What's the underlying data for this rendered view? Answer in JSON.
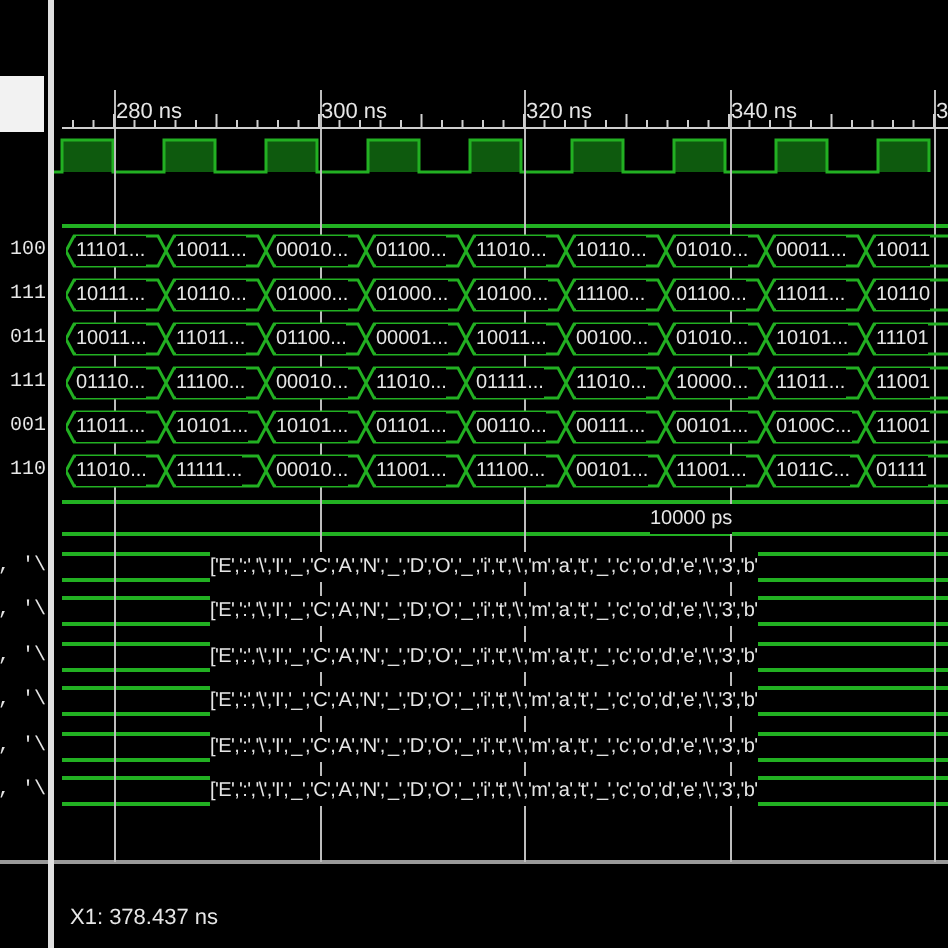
{
  "ruler": {
    "labels": [
      "280 ns",
      "300 ns",
      "320 ns",
      "340 ns",
      "3"
    ]
  },
  "signals": [
    {
      "value": "100",
      "segments": [
        "11101...",
        "10011...",
        "00010...",
        "01100...",
        "11010...",
        "10110...",
        "01010...",
        "00011...",
        "10011"
      ]
    },
    {
      "value": "111",
      "segments": [
        "10111...",
        "10110...",
        "01000...",
        "01000...",
        "10100...",
        "11100...",
        "01100...",
        "11011...",
        "10110"
      ]
    },
    {
      "value": "011",
      "segments": [
        "10011...",
        "11011...",
        "01100...",
        "00001...",
        "10011...",
        "00100...",
        "01010...",
        "10101...",
        "11101"
      ]
    },
    {
      "value": "111",
      "segments": [
        "01110...",
        "11100...",
        "00010...",
        "11010...",
        "01111...",
        "11010...",
        "10000...",
        "11011...",
        "11001"
      ]
    },
    {
      "value": "001",
      "segments": [
        "11011...",
        "10101...",
        "10101...",
        "01101...",
        "00110...",
        "00111...",
        "00101...",
        "0100C...",
        "11001"
      ]
    },
    {
      "value": "110",
      "segments": [
        "11010...",
        "11111...",
        "00010...",
        "11001...",
        "11100...",
        "00101...",
        "11001...",
        "1011C...",
        "01111"
      ]
    }
  ],
  "marker": {
    "label": "10000 ps"
  },
  "string_signals": [
    {
      "value": ", '\\",
      "text": "['E',':','\\','I','_','C','A','N','_','D','O','_','i','t','\\','m','a','t','_','c','o','d','e','\\','3','b'"
    },
    {
      "value": ", '\\",
      "text": "['E',':','\\','I','_','C','A','N','_','D','O','_','i','t','\\','m','a','t','_','c','o','d','e','\\','3','b'"
    },
    {
      "value": ", '\\",
      "text": "['E',':','\\','I','_','C','A','N','_','D','O','_','i','t','\\','m','a','t','_','c','o','d','e','\\','3','b'"
    },
    {
      "value": ", '\\",
      "text": "['E',':','\\','I','_','C','A','N','_','D','O','_','i','t','\\','m','a','t','_','c','o','d','e','\\','3','b'"
    },
    {
      "value": ", '\\",
      "text": "['E',':','\\','I','_','C','A','N','_','D','O','_','i','t','\\','m','a','t','_','c','o','d','e','\\','3','b'"
    },
    {
      "value": ", '\\",
      "text": "['E',':','\\','I','_','C','A','N','_','D','O','_','i','t','\\','m','a','t','_','c','o','d','e','\\','3','b'"
    }
  ],
  "status_bar": {
    "cursor": "X1: 378.437 ns"
  }
}
